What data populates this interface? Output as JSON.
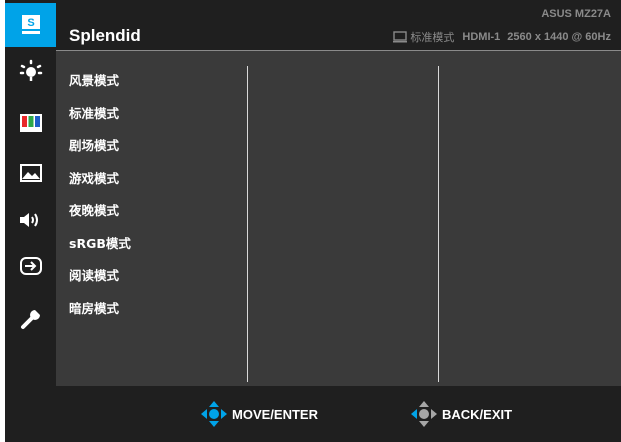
{
  "osd": {
    "title": "Splendid",
    "model": "ASUS MZ27A",
    "status": {
      "mode": "标准模式",
      "input": "HDMI-1",
      "resolution": "2560 x 1440 @ 60Hz"
    }
  },
  "sidebar": {
    "items": [
      {
        "icon": "splendid-icon",
        "active": true
      },
      {
        "icon": "blue-light-filter-icon"
      },
      {
        "icon": "color-icon"
      },
      {
        "icon": "image-icon"
      },
      {
        "icon": "sound-icon"
      },
      {
        "icon": "input-select-icon"
      },
      {
        "icon": "system-setup-icon"
      }
    ]
  },
  "modes": [
    "风景模式",
    "标准模式",
    "剧场模式",
    "游戏模式",
    "夜晚模式",
    "sRGB模式",
    "阅读模式",
    "暗房模式"
  ],
  "footer": {
    "move_enter": "MOVE/ENTER",
    "back_exit": "BACK/EXIT"
  },
  "colors": {
    "accent": "#00a3e8",
    "panel": "#3a3a3a",
    "background": "#1f1f1f",
    "muted_text": "#8a8a8a"
  }
}
